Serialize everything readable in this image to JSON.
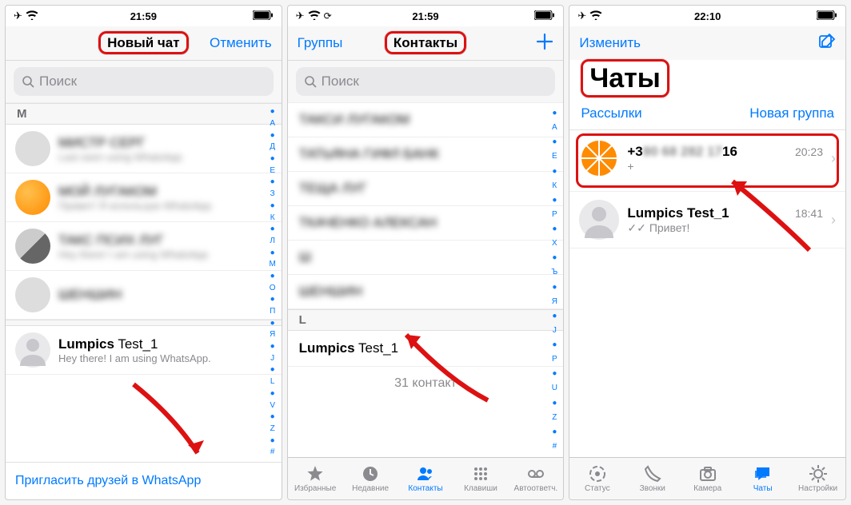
{
  "screen1": {
    "status_time": "21:59",
    "nav_title": "Новый чат",
    "nav_cancel": "Отменить",
    "search_placeholder": "Поиск",
    "section_letter": "M",
    "contacts": [
      {
        "name": "МИСТР СЕРГ",
        "sub": "Last seen using WhatsApp",
        "avatar": "gray"
      },
      {
        "name": "МОЙ ЛУГАКОМ",
        "sub": "Привет! Я использую WhatsApp",
        "avatar": "orange"
      },
      {
        "name": "ТАКС ПСИХ ЛУГ",
        "sub": "Hey there! I am using WhatsApp",
        "avatar": "bw"
      },
      {
        "name": "ШЕНШИН",
        "sub": "",
        "avatar": "gray"
      }
    ],
    "lumpics": {
      "name": "Lumpics Test_1",
      "sub": "Hey there! I am using WhatsApp."
    },
    "invite": "Пригласить друзей в WhatsApp",
    "index": [
      "●",
      "А",
      "●",
      "Д",
      "●",
      "Е",
      "●",
      "З",
      "●",
      "К",
      "●",
      "Л",
      "●",
      "М",
      "●",
      "О",
      "●",
      "П",
      "●",
      "Я",
      "●",
      "J",
      "●",
      "L",
      "●",
      "V",
      "●",
      "Z",
      "●",
      "#"
    ]
  },
  "screen2": {
    "status_time": "21:59",
    "nav_left": "Группы",
    "nav_title": "Контакты",
    "nav_right_icon": "plus",
    "search_placeholder": "Поиск",
    "blurred_rows": [
      "ТАКСИ ЛУГАКОМ",
      "ТАТЬЯНА ГИФЛ БАНК",
      "ТЕЩА ЛУГ",
      "ТКАЧЕНКО АЛЕКСАН",
      "Ш",
      "ШЕНШИН"
    ],
    "section_letter": "L",
    "lumpics_name": "Lumpics Test_1",
    "count": "31 контакт",
    "index": [
      "●",
      "А",
      "●",
      "Е",
      "●",
      "К",
      "●",
      "Р",
      "●",
      "Х",
      "●",
      "Ъ",
      "●",
      "Я",
      "●",
      "J",
      "●",
      "P",
      "●",
      "U",
      "●",
      "Z",
      "●",
      "#"
    ],
    "tabs": [
      {
        "label": "Избранные",
        "icon": "star"
      },
      {
        "label": "Недавние",
        "icon": "clock"
      },
      {
        "label": "Контакты",
        "icon": "contacts"
      },
      {
        "label": "Клавиши",
        "icon": "keypad"
      },
      {
        "label": "Автоответч.",
        "icon": "voicemail"
      }
    ],
    "active_tab": 2
  },
  "screen3": {
    "status_time": "22:10",
    "nav_left": "Изменить",
    "compose_icon": "compose",
    "big_title": "Чаты",
    "link_left": "Рассылки",
    "link_right": "Новая группа",
    "chat1": {
      "name": "+380 68 282 1716",
      "time": "20:23",
      "sub": "+"
    },
    "chat2": {
      "name": "Lumpics Test_1",
      "time": "18:41",
      "sub": "Привет!"
    },
    "tabs": [
      {
        "label": "Статус",
        "icon": "status"
      },
      {
        "label": "Звонки",
        "icon": "calls"
      },
      {
        "label": "Камера",
        "icon": "camera"
      },
      {
        "label": "Чаты",
        "icon": "chats"
      },
      {
        "label": "Настройки",
        "icon": "gear"
      }
    ],
    "active_tab": 3
  }
}
